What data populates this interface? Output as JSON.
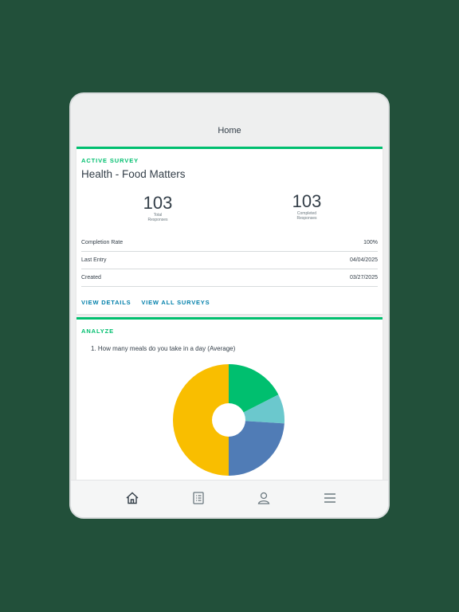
{
  "header": {
    "title": "Home"
  },
  "active_survey": {
    "section_label": "ACTIVE SURVEY",
    "title": "Health - Food Matters",
    "stats": [
      {
        "value": "103",
        "label_line1": "Total",
        "label_line2": "Responses"
      },
      {
        "value": "103",
        "label_line1": "Completed",
        "label_line2": "Responses"
      }
    ],
    "rows": [
      {
        "label": "Completion Rate",
        "value": "100%"
      },
      {
        "label": "Last Entry",
        "value": "04/04/2025"
      },
      {
        "label": "Created",
        "value": "03/27/2025"
      }
    ],
    "links": {
      "details": "VIEW DETAILS",
      "all": "VIEW ALL SURVEYS"
    }
  },
  "analyze": {
    "section_label": "ANALYZE",
    "question": "1.  How many meals do you take in a day (Average)",
    "chart_data": {
      "type": "pie",
      "slices": [
        {
          "value": 0.175,
          "color": "#00bf6f"
        },
        {
          "value": 0.085,
          "color": "#6bc8cd"
        },
        {
          "value": 0.24,
          "color": "#507cb6"
        },
        {
          "value": 0.5,
          "color": "#f9be00"
        }
      ],
      "donut_hole": true
    }
  },
  "bottom_nav": [
    {
      "name": "home-icon"
    },
    {
      "name": "surveys-list-icon"
    },
    {
      "name": "profile-icon"
    },
    {
      "name": "menu-icon"
    }
  ],
  "colors": {
    "background": "#22503a",
    "accent": "#00bf6f",
    "link": "#007faa"
  }
}
